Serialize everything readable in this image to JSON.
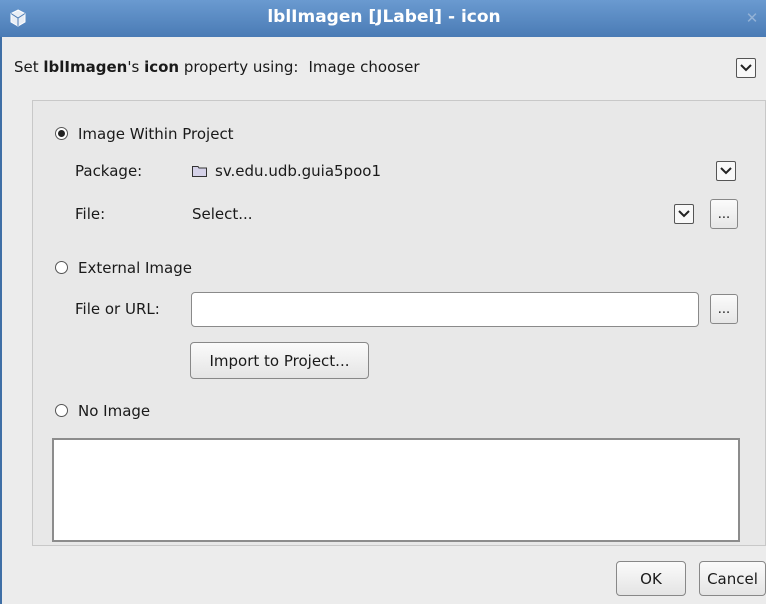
{
  "window": {
    "title": "lblImagen [JLabel] - icon",
    "close_glyph": "✕"
  },
  "source_row": {
    "prefix": "Set ",
    "component": "lblImagen",
    "possessive": "'s ",
    "property": "icon",
    "suffix": " property using:",
    "value": "Image chooser"
  },
  "options": {
    "within_project": {
      "label": "Image Within Project",
      "checked": true,
      "package_label": "Package:",
      "package_value": "sv.edu.udb.guia5poo1",
      "file_label": "File:",
      "file_value": "Select...",
      "browse_label": "..."
    },
    "external": {
      "label": "External Image",
      "checked": false,
      "file_label": "File or URL:",
      "file_value": "",
      "browse_label": "...",
      "import_label": "Import to Project..."
    },
    "none": {
      "label": "No Image",
      "checked": false
    }
  },
  "footer": {
    "ok_label": "OK",
    "cancel_label": "Cancel"
  },
  "colors": {
    "titlebar": "#4a7bb5",
    "panel": "#e8e8e8",
    "background": "#ececec"
  }
}
